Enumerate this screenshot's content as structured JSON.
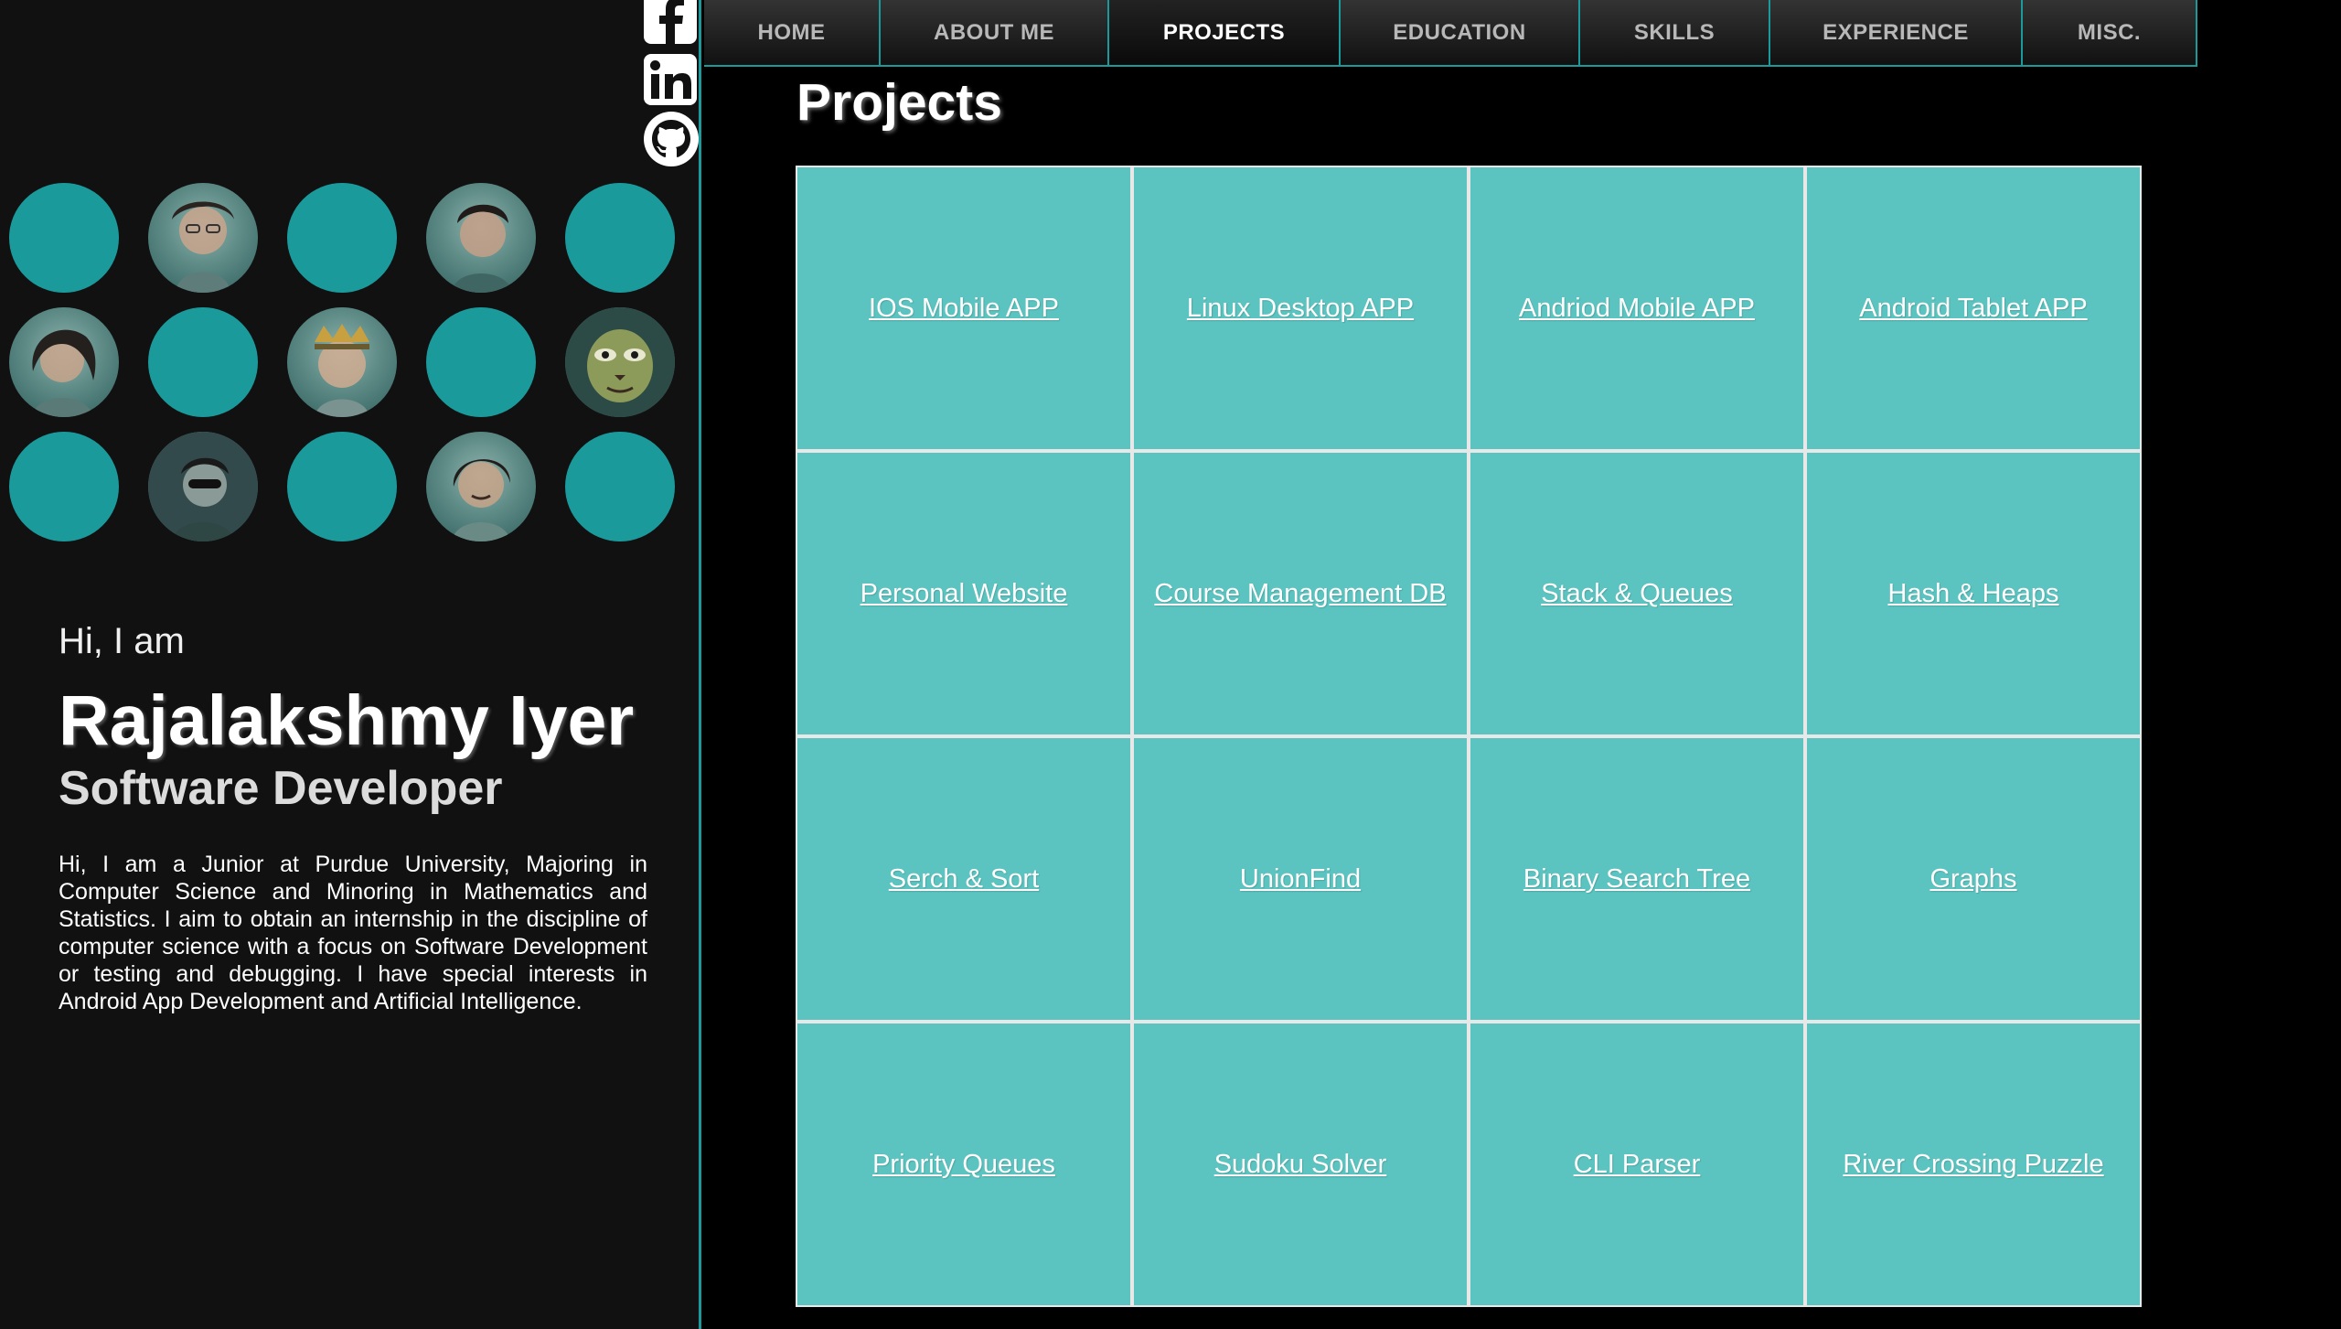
{
  "nav": {
    "items": [
      {
        "label": "HOME"
      },
      {
        "label": "ABOUT ME"
      },
      {
        "label": "PROJECTS"
      },
      {
        "label": "EDUCATION"
      },
      {
        "label": "SKILLS"
      },
      {
        "label": "EXPERIENCE"
      },
      {
        "label": "MISC."
      }
    ],
    "active": "PROJECTS"
  },
  "social": {
    "icons": [
      "facebook-icon",
      "linkedin-icon",
      "github-icon"
    ]
  },
  "profile": {
    "greeting": "Hi, I am",
    "name": "Rajalakshmy Iyer",
    "role": "Software Developer",
    "bio": "Hi, I am a Junior at Purdue University, Majoring in Computer Science and Minoring in Mathematics and Statistics. I aim to obtain an internship in the discipline of computer science with a focus on Software Development or testing and debugging. I have special interests in Android App Development and Artificial Intelligence."
  },
  "section": {
    "title": "Projects"
  },
  "projects": [
    "IOS Mobile APP",
    "Linux Desktop APP",
    "Andriod Mobile APP",
    "Android Tablet APP",
    "Personal Website",
    "Course Management DB",
    "Stack & Queues",
    "Hash & Heaps",
    "Serch & Sort",
    "UnionFind",
    "Binary Search Tree",
    "Graphs",
    "Priority Queues",
    "Sudoku Solver",
    "CLI Parser",
    "River Crossing Puzzle"
  ],
  "colors": {
    "accent": "#1a9a9a",
    "tile": "#5cc4c0",
    "panel": "#111111"
  }
}
